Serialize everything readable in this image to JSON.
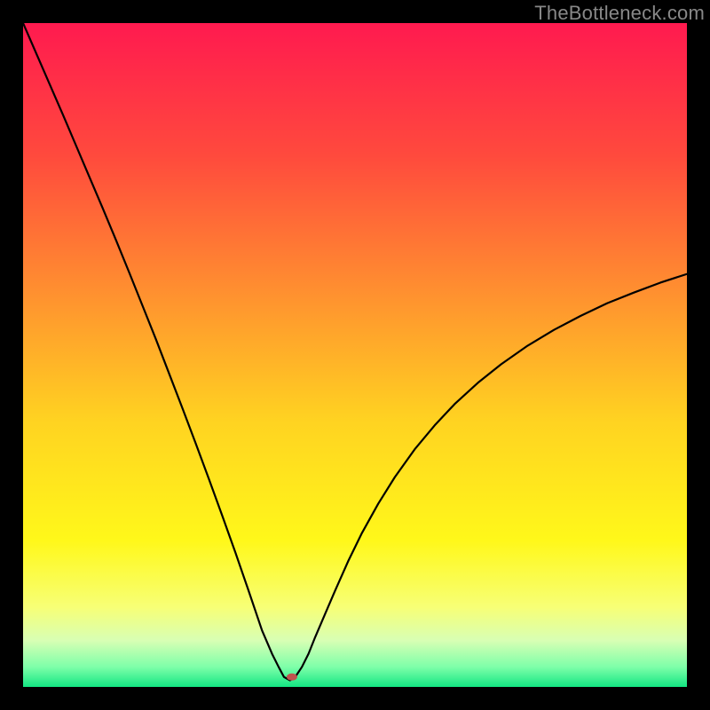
{
  "watermark": "TheBottleneck.com",
  "chart_data": {
    "type": "line",
    "title": "",
    "xlabel": "",
    "ylabel": "",
    "xlim": [
      0,
      100
    ],
    "ylim": [
      0,
      100
    ],
    "grid": false,
    "legend": false,
    "background": {
      "type": "vertical-gradient",
      "stops": [
        {
          "pos": 0.0,
          "color": "#ff1a4f"
        },
        {
          "pos": 0.2,
          "color": "#ff4a3d"
        },
        {
          "pos": 0.4,
          "color": "#ff8e30"
        },
        {
          "pos": 0.6,
          "color": "#ffd321"
        },
        {
          "pos": 0.78,
          "color": "#fff81a"
        },
        {
          "pos": 0.88,
          "color": "#f7ff76"
        },
        {
          "pos": 0.93,
          "color": "#d8ffb4"
        },
        {
          "pos": 0.97,
          "color": "#7effa9"
        },
        {
          "pos": 1.0,
          "color": "#13e683"
        }
      ]
    },
    "marker": {
      "x": 40.5,
      "y": 1.5,
      "color": "#c0544e",
      "rx": 6,
      "ry": 4
    },
    "series": [
      {
        "name": "curve",
        "color": "#000000",
        "x": [
          0.0,
          2.0,
          4.0,
          6.0,
          8.0,
          10.0,
          12.0,
          14.0,
          16.0,
          18.0,
          20.0,
          22.0,
          24.0,
          26.0,
          28.0,
          30.0,
          32.0,
          34.0,
          36.0,
          37.5,
          38.5,
          39.3,
          40.2,
          41.0,
          42.0,
          43.0,
          44.0,
          45.5,
          47.0,
          49.0,
          51.0,
          53.5,
          56.0,
          59.0,
          62.0,
          65.0,
          68.5,
          72.0,
          76.0,
          80.0,
          84.0,
          88.0,
          92.0,
          96.0,
          100.0
        ],
        "y": [
          100.0,
          95.4,
          90.8,
          86.2,
          81.5,
          76.8,
          72.1,
          67.3,
          62.4,
          57.4,
          52.4,
          47.2,
          42.0,
          36.7,
          31.3,
          25.8,
          20.2,
          14.4,
          8.5,
          5.0,
          3.0,
          1.5,
          1.0,
          1.5,
          3.0,
          5.0,
          7.5,
          11.0,
          14.5,
          19.0,
          23.1,
          27.6,
          31.6,
          35.8,
          39.4,
          42.6,
          45.8,
          48.6,
          51.4,
          53.8,
          55.9,
          57.8,
          59.4,
          60.9,
          62.2
        ]
      }
    ]
  }
}
